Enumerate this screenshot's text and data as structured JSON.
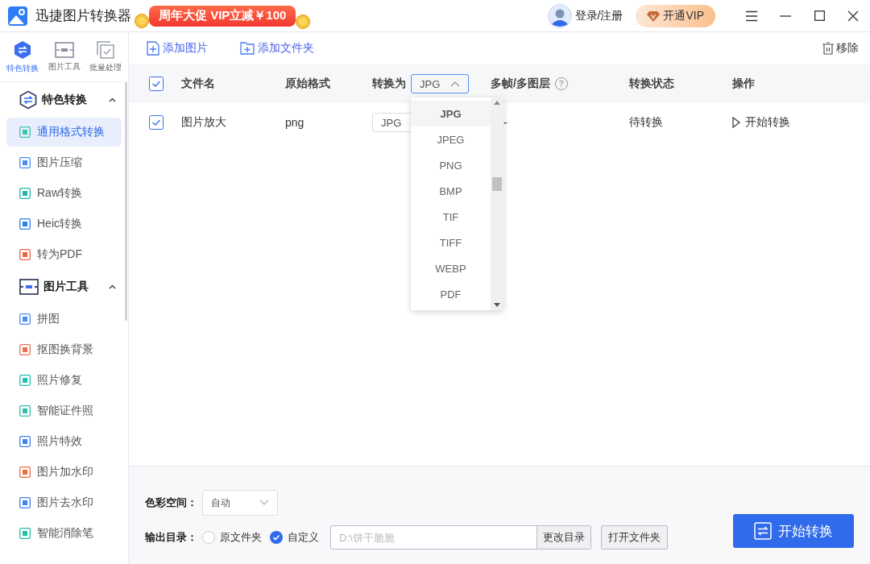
{
  "app": {
    "title": "迅捷图片转换器",
    "promo": "周年大促 VIP立减￥100"
  },
  "header": {
    "login": "登录/注册",
    "vip": "开通VIP"
  },
  "rail": [
    {
      "label": "特色转换",
      "selected": true
    },
    {
      "label": "图片工具",
      "selected": false
    },
    {
      "label": "批量处理",
      "selected": false
    }
  ],
  "sidebar": {
    "groups": [
      {
        "title": "特色转换",
        "expanded": true,
        "items": [
          {
            "label": "通用格式转换",
            "selected": true,
            "color": "#3ec6a8"
          },
          {
            "label": "图片压缩",
            "selected": false,
            "color": "#4a8cf7"
          },
          {
            "label": "Raw转换",
            "selected": false,
            "color": "#1fb5a5"
          },
          {
            "label": "Heic转换",
            "selected": false,
            "color": "#2f7cf6"
          },
          {
            "label": "转为PDF",
            "selected": false,
            "color": "#f0643c"
          }
        ]
      },
      {
        "title": "图片工具",
        "expanded": true,
        "items": [
          {
            "label": "拼图",
            "selected": false,
            "color": "#4a8cf7"
          },
          {
            "label": "抠图换背景",
            "selected": false,
            "color": "#f07050"
          },
          {
            "label": "照片修复",
            "selected": false,
            "color": "#1fbfae"
          },
          {
            "label": "智能证件照",
            "selected": false,
            "color": "#2fc0a8"
          },
          {
            "label": "照片特效",
            "selected": false,
            "color": "#3c82f6"
          },
          {
            "label": "图片加水印",
            "selected": false,
            "color": "#f06a3c"
          },
          {
            "label": "图片去水印",
            "selected": false,
            "color": "#3c82f6"
          },
          {
            "label": "智能消除笔",
            "selected": false,
            "color": "#1fbfa0"
          }
        ]
      }
    ]
  },
  "toolbar": {
    "add_image": "添加图片",
    "add_folder": "添加文件夹",
    "remove": "移除"
  },
  "table": {
    "select_all_checked": true,
    "columns": [
      {
        "label": "文件名"
      },
      {
        "label": "原始格式"
      },
      {
        "label": "转换为",
        "kind": "select",
        "value": "JPG",
        "expanded": true
      },
      {
        "label": "多帧/多图层",
        "help": "?"
      },
      {
        "label": "转换状态"
      },
      {
        "label": "操作"
      }
    ],
    "rows": [
      {
        "checked": true,
        "name": "图片放大",
        "format": "png",
        "target": "JPG",
        "frames": "-",
        "status": "待转换",
        "action": "开始转换"
      }
    ],
    "format_options": [
      {
        "label": "JPG",
        "selected": true
      },
      {
        "label": "JPEG",
        "selected": false
      },
      {
        "label": "PNG",
        "selected": false
      },
      {
        "label": "BMP",
        "selected": false
      },
      {
        "label": "TIF",
        "selected": false
      },
      {
        "label": "TIFF",
        "selected": false
      },
      {
        "label": "WEBP",
        "selected": false
      },
      {
        "label": "PDF",
        "selected": false
      }
    ]
  },
  "bottom": {
    "color_space_label": "色彩空间：",
    "color_space": "自动",
    "output_label": "输出目录：",
    "output_options": [
      {
        "label": "原文件夹",
        "selected": false
      },
      {
        "label": "自定义",
        "selected": true
      }
    ],
    "path_placeholder": "D:\\饼干脆脆",
    "change_dir": "更改目录",
    "open_folder": "打开文件夹",
    "convert": "开始转换"
  }
}
